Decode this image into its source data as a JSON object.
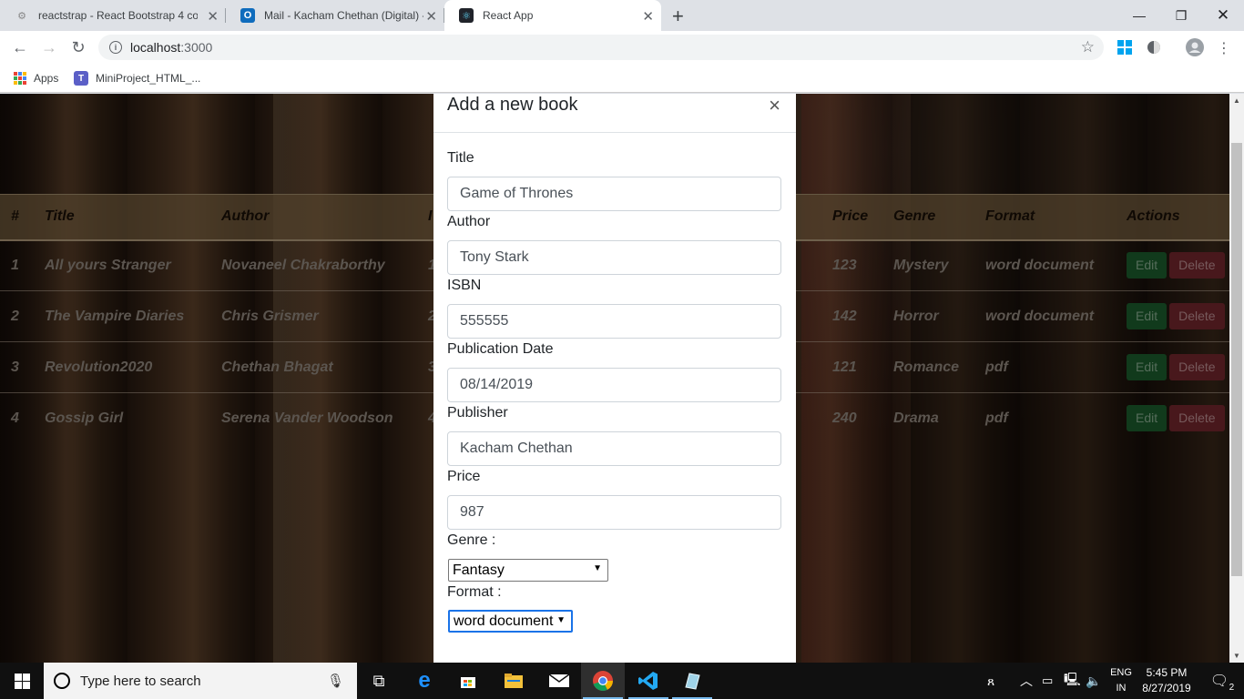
{
  "browser": {
    "tabs": [
      {
        "title": "reactstrap - React Bootstrap 4 co",
        "state": "inactive"
      },
      {
        "title": "Mail - Kacham Chethan (Digital) -",
        "state": "inactive"
      },
      {
        "title": "React App",
        "state": "active"
      }
    ],
    "url_host": "localhost",
    "url_port": ":3000",
    "bookmarks": [
      {
        "label": "Apps"
      },
      {
        "label": "MiniProject_HTML_..."
      }
    ]
  },
  "table": {
    "headers": [
      "#",
      "Title",
      "Author",
      "I",
      "Price",
      "Genre",
      "Format",
      "Actions"
    ],
    "rows": [
      {
        "num": "1",
        "title": "All yours Stranger",
        "author": "Novaneel Chakraborthy",
        "isbn": "1",
        "price": "123",
        "genre": "Mystery",
        "format": "word document"
      },
      {
        "num": "2",
        "title": "The Vampire Diaries",
        "author": "Chris Grismer",
        "isbn": "2",
        "price": "142",
        "genre": "Horror",
        "format": "word document"
      },
      {
        "num": "3",
        "title": "Revolution2020",
        "author": "Chethan Bhagat",
        "isbn": "3",
        "price": "121",
        "genre": "Romance",
        "format": "pdf"
      },
      {
        "num": "4",
        "title": "Gossip Girl",
        "author": "Serena Vander Woodson",
        "isbn": "4",
        "price": "240",
        "genre": "Drama",
        "format": "pdf"
      }
    ],
    "edit_label": "Edit",
    "delete_label": "Delete"
  },
  "modal": {
    "title": "Add a new book",
    "close_glyph": "×",
    "fields": {
      "title": {
        "label": "Title",
        "value": "Game of Thrones"
      },
      "author": {
        "label": "Author",
        "value": "Tony Stark"
      },
      "isbn": {
        "label": "ISBN",
        "value": "555555"
      },
      "publication_date": {
        "label": "Publication Date",
        "value": "08/14/2019"
      },
      "publisher": {
        "label": "Publisher",
        "value": "Kacham Chethan"
      },
      "price": {
        "label": "Price",
        "value": "987"
      }
    },
    "genre": {
      "label": "Genre :",
      "selected": "Fantasy"
    },
    "format": {
      "label": "Format :",
      "selected": "word document"
    }
  },
  "taskbar": {
    "search_placeholder": "Type here to search",
    "lang_line1": "ENG",
    "lang_line2": "IN",
    "time": "5:45 PM",
    "date": "8/27/2019",
    "notification_count": "2"
  },
  "colors": {
    "edit": "#28a745",
    "delete": "#dc3545",
    "accent_focus": "#1a73e8",
    "taskbar": "#101010"
  }
}
